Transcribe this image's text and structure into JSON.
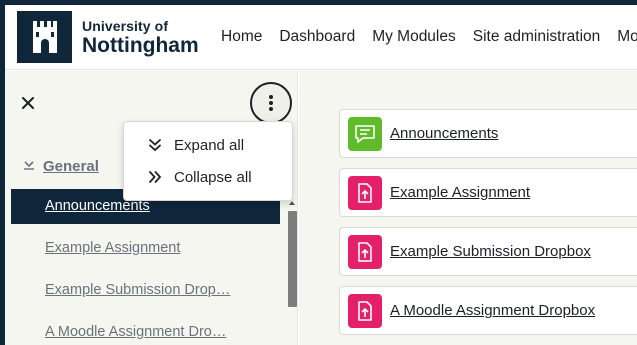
{
  "brand": {
    "line1": "University of",
    "line2": "Nottingham",
    "navy": "#10263b"
  },
  "nav": {
    "items": [
      "Home",
      "Dashboard",
      "My Modules",
      "Site administration",
      "Mo"
    ]
  },
  "drawer": {
    "close_icon": "close-icon",
    "menu_icon": "kebab-menu-icon",
    "section_title": "General",
    "items": [
      "Announcements",
      "Example Assignment",
      "Example Submission Drop…",
      "A Moodle Assignment Dro…"
    ]
  },
  "menu": {
    "expand_label": "Expand all",
    "collapse_label": "Collapse all"
  },
  "activities": [
    {
      "label": "Announcements ",
      "icon": "forum-icon",
      "color": "#5fbb2a"
    },
    {
      "label": "Example Assignment",
      "icon": "assignment-icon",
      "color": "#e5206a"
    },
    {
      "label": "Example Submission Dropbox",
      "icon": "assignment-icon",
      "color": "#e5206a"
    },
    {
      "label": "A Moodle Assignment Dropbox",
      "icon": "assignment-icon",
      "color": "#e5206a"
    }
  ]
}
